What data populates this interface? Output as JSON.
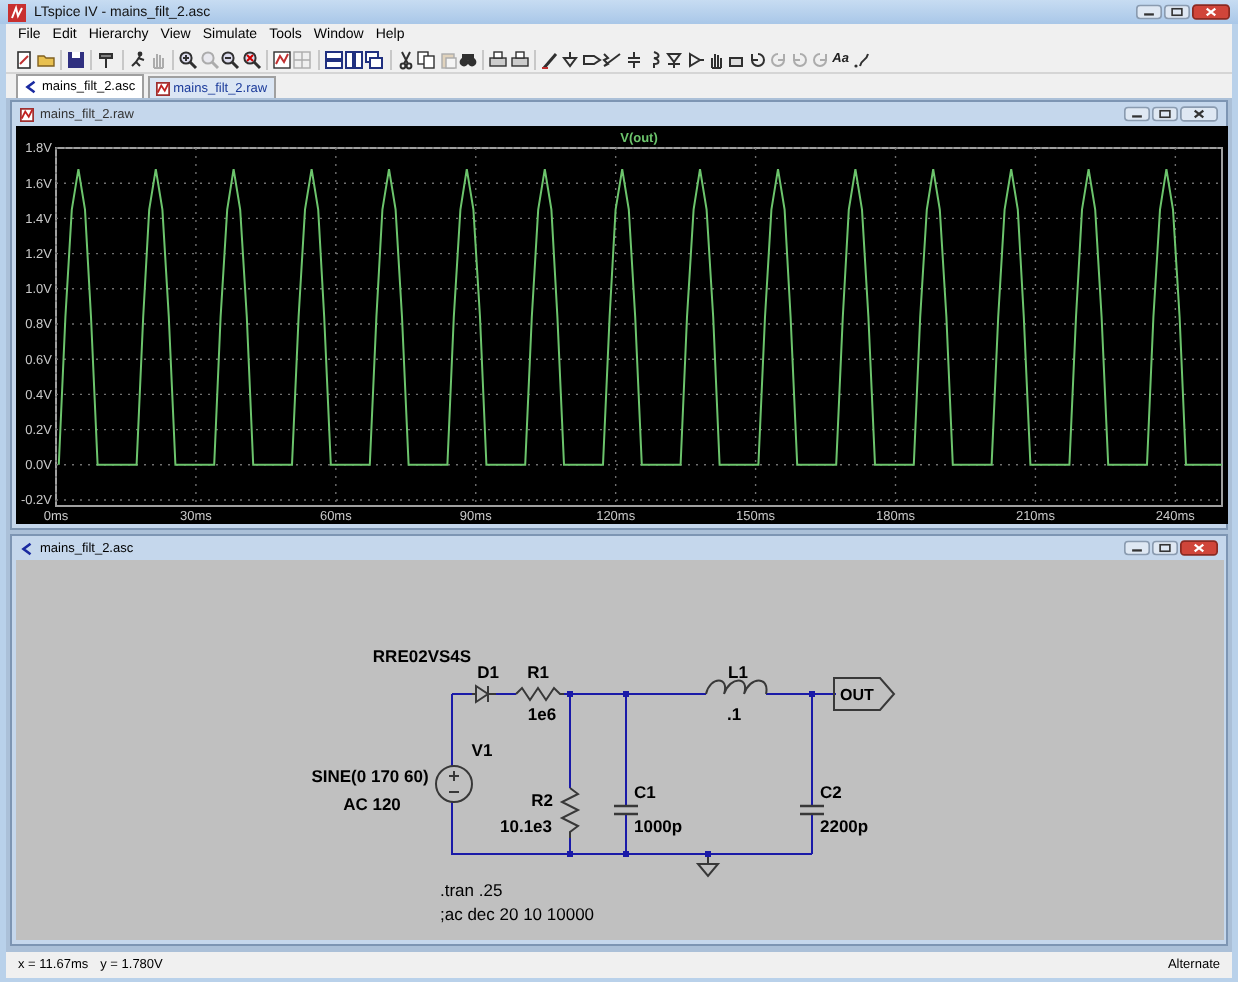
{
  "window": {
    "title": "LTspice IV - mains_filt_2.asc"
  },
  "menu": [
    "File",
    "Edit",
    "Hierarchy",
    "View",
    "Simulate",
    "Tools",
    "Window",
    "Help"
  ],
  "toolbar": [
    {
      "disabled": false
    },
    {
      "disabled": false
    },
    {
      "disabled": false
    },
    {
      "disabled": false
    },
    {
      "disabled": false
    },
    {
      "disabled": true
    },
    {
      "disabled": false
    },
    {
      "disabled": true
    },
    {
      "disabled": false
    },
    {
      "disabled": false
    },
    {
      "disabled": false
    },
    {
      "disabled": true
    },
    {
      "disabled": false
    },
    {
      "disabled": false
    },
    {
      "disabled": false
    },
    {
      "disabled": false
    },
    {
      "disabled": false
    },
    {
      "disabled": true
    },
    {
      "disabled": false
    },
    {
      "disabled": false
    },
    {
      "disabled": false
    },
    {
      "disabled": false
    },
    {
      "disabled": false
    },
    {
      "disabled": false
    },
    {
      "disabled": false
    },
    {
      "disabled": false
    },
    {
      "disabled": false
    },
    {
      "disabled": false
    },
    {
      "disabled": false
    },
    {
      "disabled": false
    },
    {
      "disabled": false
    },
    {
      "disabled": false
    },
    {
      "disabled": true
    },
    {
      "disabled": true
    },
    {
      "disabled": true
    },
    {
      "disabled": false,
      "label": "Aa"
    },
    {
      "disabled": false
    }
  ],
  "tabs": [
    {
      "label": "mains_filt_2.asc",
      "kind": "schematic",
      "selected": true
    },
    {
      "label": "mains_filt_2.raw",
      "kind": "waveform",
      "selected": false
    }
  ],
  "waveform_window": {
    "title": "mains_filt_2.raw",
    "active": false,
    "chart_data": {
      "type": "line",
      "grid": true,
      "xlim": [
        0,
        250
      ],
      "ylim": [
        -0.2,
        1.8
      ],
      "xticks": [
        {
          "value": 0,
          "label": "0ms"
        },
        {
          "value": 30,
          "label": "30ms"
        },
        {
          "value": 60,
          "label": "60ms"
        },
        {
          "value": 90,
          "label": "90ms"
        },
        {
          "value": 120,
          "label": "120ms"
        },
        {
          "value": 150,
          "label": "150ms"
        },
        {
          "value": 180,
          "label": "180ms"
        },
        {
          "value": 210,
          "label": "210ms"
        },
        {
          "value": 240,
          "label": "240ms"
        }
      ],
      "yticks": [
        {
          "value": -0.2,
          "label": "-0.2V"
        },
        {
          "value": 0,
          "label": "0.0V"
        },
        {
          "value": 0.2,
          "label": "0.2V"
        },
        {
          "value": 0.4,
          "label": "0.4V"
        },
        {
          "value": 0.6,
          "label": "0.6V"
        },
        {
          "value": 0.8,
          "label": "0.8V"
        },
        {
          "value": 1.0,
          "label": "1.0V"
        },
        {
          "value": 1.2,
          "label": "1.2V"
        },
        {
          "value": 1.4,
          "label": "1.4V"
        },
        {
          "value": 1.6,
          "label": "1.6V"
        },
        {
          "value": 1.8,
          "label": "1.8V"
        }
      ],
      "x": [
        0.6,
        2.0,
        3.4,
        4.8,
        6.2,
        7.5,
        8.9,
        17.3,
        18.7,
        20.0,
        21.4,
        22.8,
        24.2,
        25.6,
        33.9,
        35.3,
        36.7,
        38.1,
        39.5,
        40.9,
        42.3,
        50.6,
        52.0,
        53.4,
        54.8,
        56.2,
        57.5,
        58.9,
        67.3,
        68.7,
        70.0,
        71.4,
        72.8,
        74.2,
        75.6,
        83.9,
        85.3,
        86.7,
        88.1,
        89.5,
        90.9,
        92.3,
        100.6,
        102.0,
        103.4,
        104.8,
        106.2,
        107.5,
        108.9,
        117.3,
        118.7,
        120.0,
        121.4,
        122.8,
        124.2,
        125.6,
        133.9,
        135.3,
        136.7,
        138.1,
        139.5,
        140.9,
        142.3,
        150.6,
        152.0,
        153.4,
        154.8,
        156.2,
        157.5,
        158.9,
        167.3,
        168.7,
        170.0,
        171.4,
        172.8,
        174.2,
        175.6,
        183.9,
        185.3,
        186.7,
        188.1,
        189.5,
        190.9,
        192.3,
        200.6,
        202.0,
        203.4,
        204.8,
        206.2,
        207.5,
        208.9,
        217.3,
        218.7,
        220.0,
        221.4,
        222.8,
        224.2,
        225.6,
        233.9,
        235.3,
        236.7,
        238.1,
        239.5,
        240.9,
        242.3,
        250.0
      ],
      "series": [
        {
          "name": "V(out)",
          "color": "#6cc46c",
          "values": [
            0,
            0.84,
            1.45,
            1.68,
            1.45,
            0.84,
            0,
            0,
            0.84,
            1.45,
            1.68,
            1.45,
            0.84,
            0,
            0,
            0.84,
            1.45,
            1.68,
            1.45,
            0.84,
            0,
            0,
            0.84,
            1.45,
            1.68,
            1.45,
            0.84,
            0,
            0,
            0.84,
            1.45,
            1.68,
            1.45,
            0.84,
            0,
            0,
            0.84,
            1.45,
            1.68,
            1.45,
            0.84,
            0,
            0,
            0.84,
            1.45,
            1.68,
            1.45,
            0.84,
            0,
            0,
            0.84,
            1.45,
            1.68,
            1.45,
            0.84,
            0,
            0,
            0.84,
            1.45,
            1.68,
            1.45,
            0.84,
            0,
            0,
            0.84,
            1.45,
            1.68,
            1.45,
            0.84,
            0,
            0,
            0.84,
            1.45,
            1.68,
            1.45,
            0.84,
            0,
            0,
            0.84,
            1.45,
            1.68,
            1.45,
            0.84,
            0,
            0,
            0.84,
            1.45,
            1.68,
            1.45,
            0.84,
            0,
            0,
            0.84,
            1.45,
            1.68,
            1.45,
            0.84,
            0,
            0,
            0.84,
            1.45,
            1.68,
            1.45,
            0.84,
            0,
            0
          ]
        }
      ]
    }
  },
  "schematic_window": {
    "title": "mains_filt_2.asc",
    "active": true,
    "components": [
      {
        "kind": "diode",
        "ref": "D1",
        "value": "RRE02VS4S"
      },
      {
        "kind": "resistor",
        "ref": "R1",
        "value": "1e6"
      },
      {
        "kind": "inductor",
        "ref": "L1",
        "value": ".1"
      },
      {
        "kind": "voltage_source",
        "ref": "V1",
        "value": "SINE(0 170 60)",
        "ac": "AC 120"
      },
      {
        "kind": "resistor",
        "ref": "R2",
        "value": "10.1e3"
      },
      {
        "kind": "capacitor",
        "ref": "C1",
        "value": "1000p"
      },
      {
        "kind": "capacitor",
        "ref": "C2",
        "value": "2200p"
      }
    ],
    "net_labels": [
      "OUT"
    ],
    "directives": [
      ".tran .25",
      ";ac dec 20 10 10000"
    ]
  },
  "status_bar": {
    "cursor_x": "x = 11.67ms",
    "cursor_y": "y = 1.780V",
    "mode": "Alternate"
  }
}
